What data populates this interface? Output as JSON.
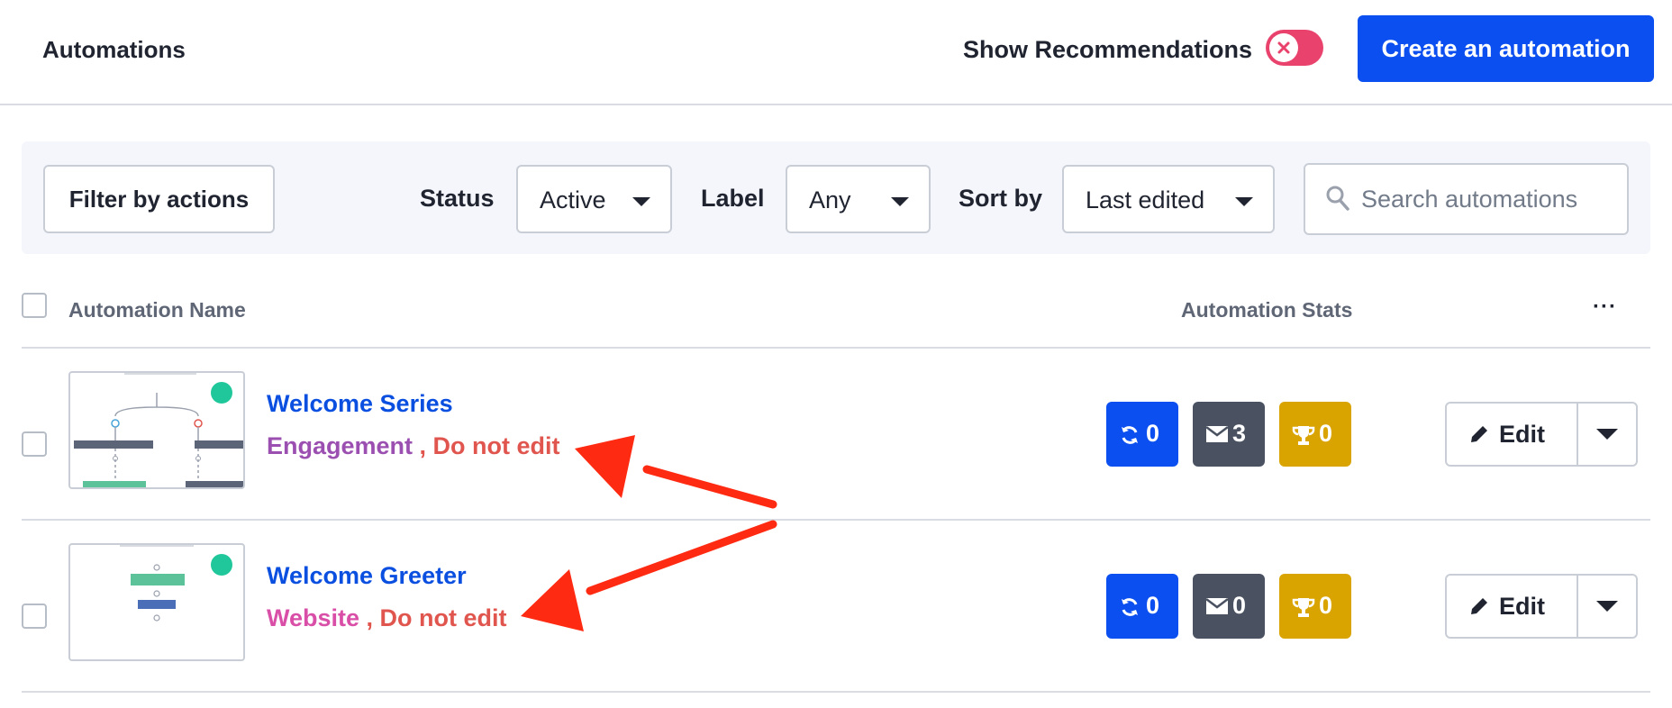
{
  "header": {
    "title": "Automations",
    "show_recommendations_label": "Show Recommendations",
    "create_button_label": "Create an automation"
  },
  "filters": {
    "filter_button_label": "Filter by actions",
    "status_label": "Status",
    "status_value": "Active",
    "label_label": "Label",
    "label_value": "Any",
    "sort_label": "Sort by",
    "sort_value": "Last edited",
    "search_placeholder": "Search automations"
  },
  "table": {
    "col_name": "Automation Name",
    "col_stats": "Automation Stats",
    "more_label": "···",
    "rows": [
      {
        "name": "Welcome Series",
        "label_primary": "Engagement",
        "label_primary_color": "#9b4fb0",
        "separator": " , ",
        "label_secondary": "Do not edit",
        "stat_contacts": "0",
        "stat_emails": "3",
        "stat_goals": "0",
        "edit_label": "Edit"
      },
      {
        "name": "Welcome Greeter",
        "label_primary": "Website",
        "label_primary_color": "#d94fa8",
        "separator": " , ",
        "label_secondary": "Do not edit",
        "stat_contacts": "0",
        "stat_emails": "0",
        "stat_goals": "0",
        "edit_label": "Edit"
      }
    ]
  },
  "colors": {
    "accent": "#0b4ff0",
    "toggle_off": "#e8426d",
    "status_active_dot": "#1fc79a",
    "annotation_arrow": "#ff2a12",
    "do_not_edit": "#e0564f"
  }
}
